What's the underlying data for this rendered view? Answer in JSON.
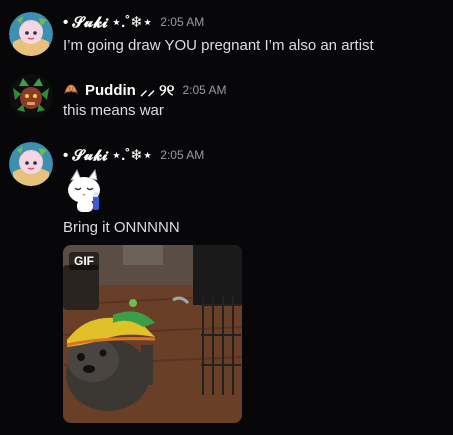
{
  "messages": [
    {
      "username": "• 𝓢𝓾𝓴𝓲 ⋆.˚❄︎⋆",
      "timestamp": "2:05 AM",
      "text": "I’m going draw YOU pregnant I’m also an artist"
    },
    {
      "username": "Puddin ⸝⸝ ୨୧",
      "timestamp": "2:05 AM",
      "role_icon": "croissant-icon",
      "text": "this means war"
    },
    {
      "username": "• 𝓢𝓾𝓴𝓲 ⋆.˚❄︎⋆",
      "timestamp": "2:05 AM",
      "sticker": "sleeping-cat-sticker",
      "text": "Bring it ONNNNN",
      "gif_badge": "GIF"
    }
  ],
  "colors": {
    "background": "#070709",
    "username": "#ffffff",
    "timestamp": "#949ba4",
    "text": "#dbdee1"
  }
}
